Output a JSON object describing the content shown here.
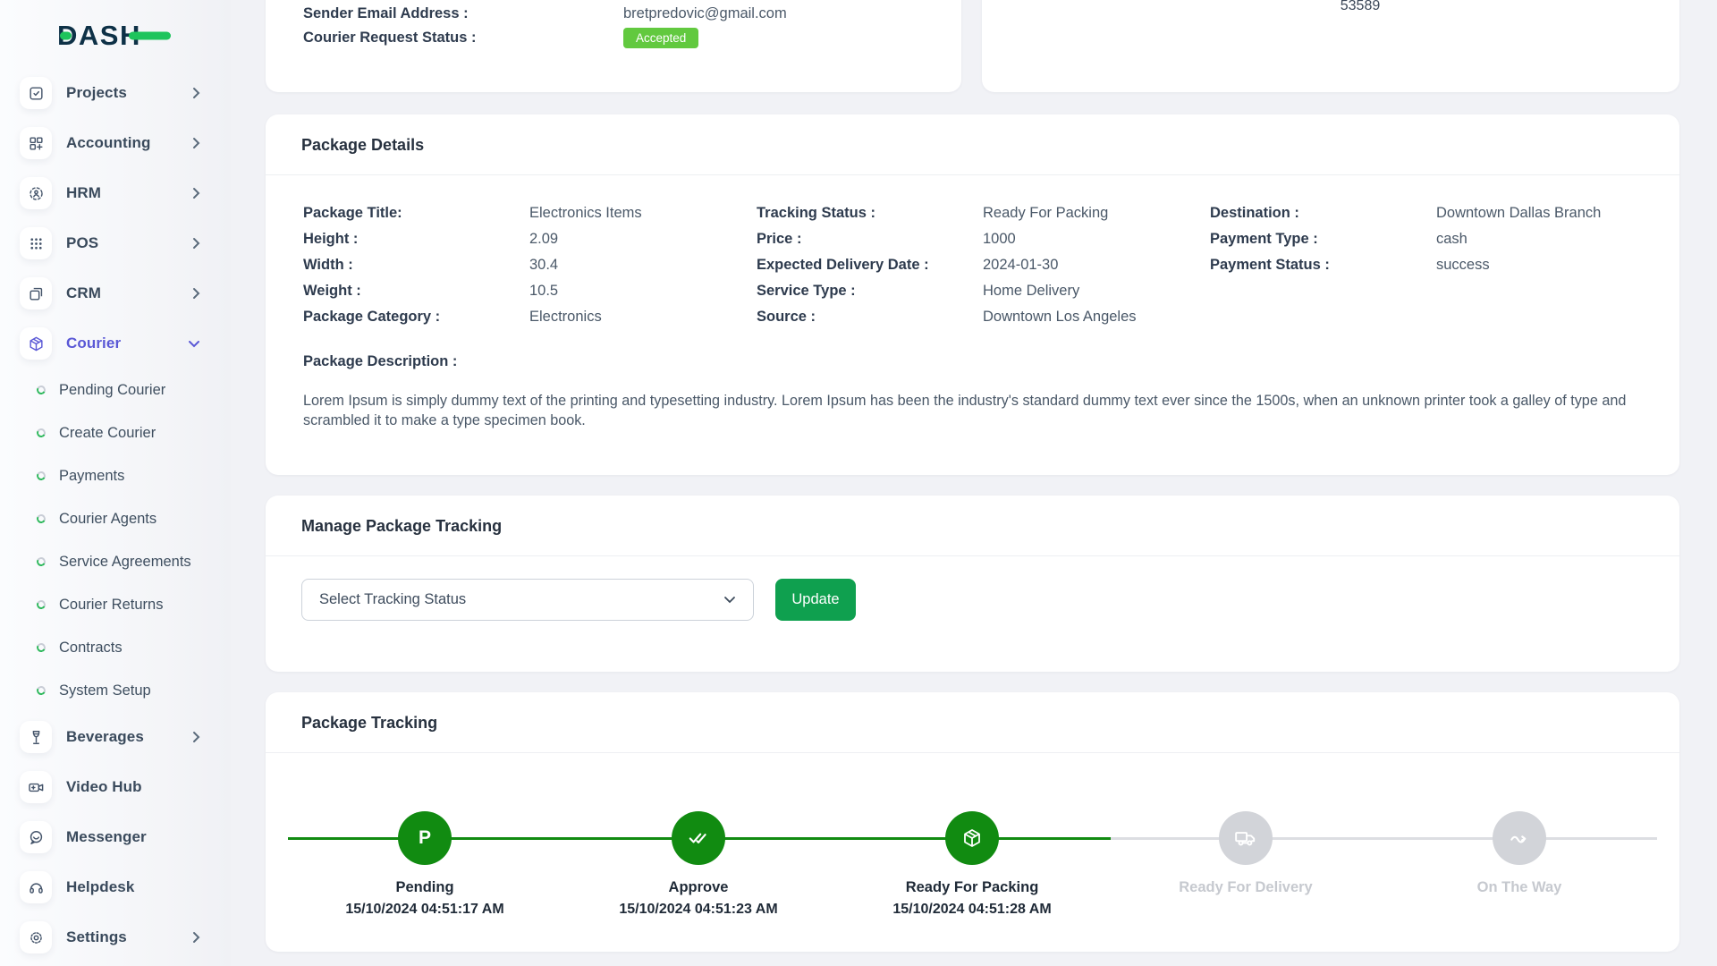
{
  "brand": {
    "logo_text": "DASH"
  },
  "colors": {
    "accent_green": "#1ec45c",
    "badge_green": "#62c93f",
    "button_green": "#0fa04f",
    "timeline_green": "#118b11",
    "active_purple": "#5a58d6"
  },
  "sidebar": {
    "items": [
      {
        "label": "Projects"
      },
      {
        "label": "Accounting"
      },
      {
        "label": "HRM"
      },
      {
        "label": "POS"
      },
      {
        "label": "CRM"
      },
      {
        "label": "Courier"
      },
      {
        "label": "Beverages"
      },
      {
        "label": "Video Hub"
      },
      {
        "label": "Messenger"
      },
      {
        "label": "Helpdesk"
      },
      {
        "label": "Settings"
      }
    ],
    "courier_submenu": [
      {
        "label": "Pending Courier"
      },
      {
        "label": "Create Courier"
      },
      {
        "label": "Payments"
      },
      {
        "label": "Courier Agents"
      },
      {
        "label": "Service Agreements"
      },
      {
        "label": "Courier Returns"
      },
      {
        "label": "Contracts"
      },
      {
        "label": "System Setup"
      }
    ]
  },
  "request_card": {
    "email_label": "Sender Email Address :",
    "email_value": "bretpredovic@gmail.com",
    "status_label": "Courier Request Status :",
    "status_badge": "Accepted"
  },
  "barcode_card": {
    "number": "53589"
  },
  "package_details": {
    "title": "Package Details",
    "col1": [
      {
        "label": "Package Title:",
        "value": "Electronics Items"
      },
      {
        "label": "Height :",
        "value": "2.09"
      },
      {
        "label": "Width :",
        "value": "30.4"
      },
      {
        "label": "Weight :",
        "value": "10.5"
      },
      {
        "label": "Package Category :",
        "value": "Electronics"
      }
    ],
    "col2": [
      {
        "label": "Tracking Status :",
        "value": "Ready For Packing"
      },
      {
        "label": "Price :",
        "value": "1000"
      },
      {
        "label": "Expected Delivery Date :",
        "value": "2024-01-30"
      },
      {
        "label": "Service Type :",
        "value": "Home Delivery"
      },
      {
        "label": "Source :",
        "value": "Downtown Los Angeles"
      }
    ],
    "col3": [
      {
        "label": "Destination :",
        "value": "Downtown Dallas Branch"
      },
      {
        "label": "Payment Type :",
        "value": "cash"
      },
      {
        "label": "Payment Status :",
        "value": "success"
      }
    ],
    "description_label": "Package Description :",
    "description": "Lorem Ipsum is simply dummy text of the printing and typesetting industry. Lorem Ipsum has been the industry's standard dummy text ever since the 1500s, when an unknown printer took a galley of type and scrambled it to make a type specimen book."
  },
  "manage_tracking": {
    "title": "Manage Package Tracking",
    "select_value": "Select Tracking Status",
    "update_label": "Update"
  },
  "package_tracking": {
    "title": "Package Tracking",
    "steps": [
      {
        "name": "Pending",
        "timestamp": "15/10/2024 04:51:17 AM",
        "state": "done"
      },
      {
        "name": "Approve",
        "timestamp": "15/10/2024 04:51:23 AM",
        "state": "done"
      },
      {
        "name": "Ready For Packing",
        "timestamp": "15/10/2024 04:51:28 AM",
        "state": "done"
      },
      {
        "name": "Ready For Delivery",
        "timestamp": "",
        "state": "pending"
      },
      {
        "name": "On The Way",
        "timestamp": "",
        "state": "pending"
      }
    ]
  }
}
